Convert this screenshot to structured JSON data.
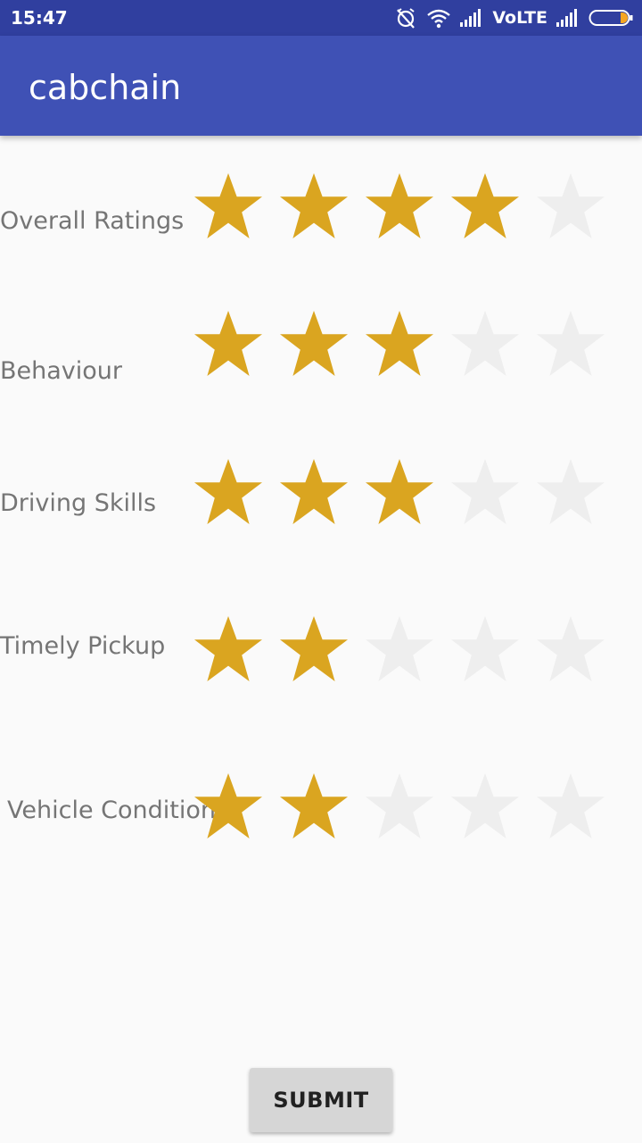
{
  "status_bar": {
    "time": "15:47",
    "network_label": "VoLTE"
  },
  "app_bar": {
    "title": "cabchain"
  },
  "ratings": [
    {
      "label": "Overall Ratings",
      "value": 4,
      "max": 5
    },
    {
      "label": "Behaviour",
      "value": 3,
      "max": 5
    },
    {
      "label": "Driving Skills",
      "value": 3,
      "max": 5
    },
    {
      "label": "Timely Pickup",
      "value": 2,
      "max": 5
    },
    {
      "label": "Vehicle Condition",
      "value": 2,
      "max": 5
    }
  ],
  "submit_label": "SUBMIT",
  "colors": {
    "star_filled": "#daa520",
    "star_empty": "#eeeeee",
    "app_bar": "#3f51b5",
    "status_bar": "#303f9f"
  }
}
